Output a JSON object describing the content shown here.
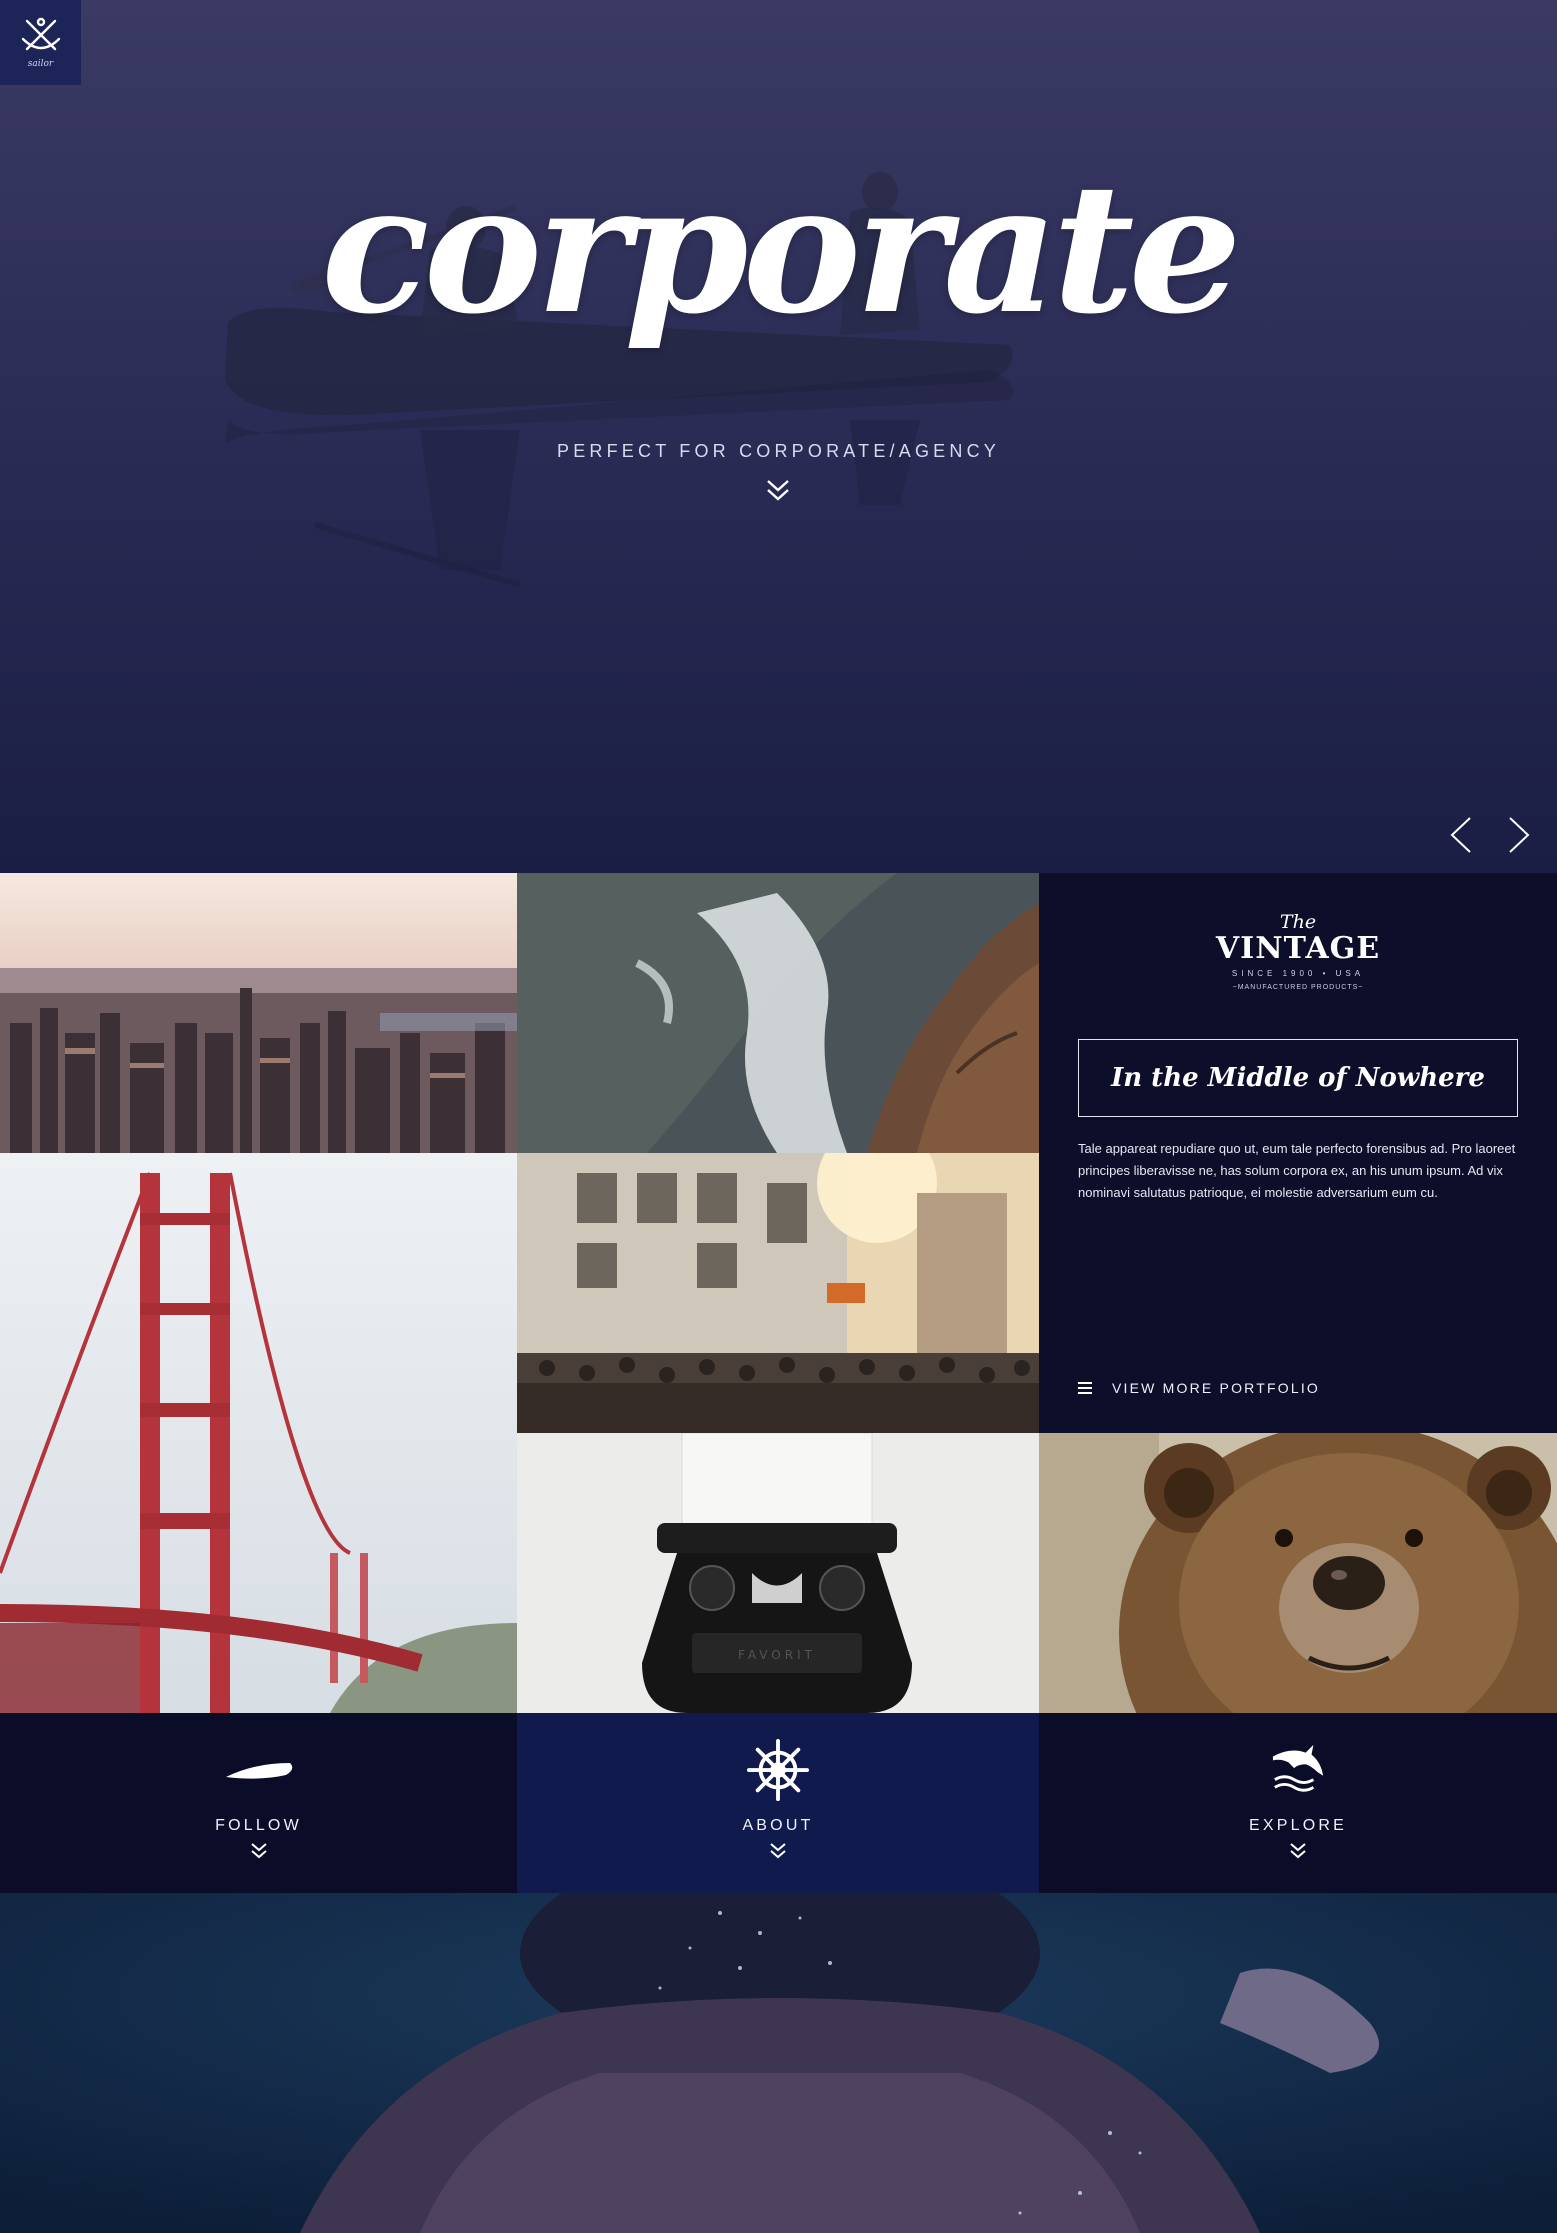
{
  "logo": {
    "icon": "anchor-icon",
    "subtext": "sailor"
  },
  "hero": {
    "title": "corporate",
    "subtitle": "PERFECT FOR CORPORATE/AGENCY",
    "scroll_icon": "double-chevron-down-icon",
    "prev_icon": "chevron-left-icon",
    "next_icon": "chevron-right-icon"
  },
  "portfolio": {
    "tiles": [
      "city skyline",
      "ocean wave on rocks",
      "golden gate bridge",
      "city street",
      "typewriter",
      "bear"
    ],
    "vintage": {
      "the": "The",
      "main": "VINTAGE",
      "since": "SINCE 1900 • USA",
      "manufactured": "~MANUFACTURED PRODUCTS~"
    },
    "tagline": "In the Middle of Nowhere",
    "description": "Tale appareat repudiare quo ut, eum tale perfecto forensibus ad. Pro laoreet principes liberavisse ne, has solum corpora ex, an his unum ipsum. Ad vix nominavi salutatus patrioque, ei molestie adversarium eum cu.",
    "more_link": "VIEW MORE PORTFOLIO",
    "more_icon": "menu-icon"
  },
  "features": [
    {
      "label": "FOLLOW",
      "icon": "surfboard-icon"
    },
    {
      "label": "ABOUT",
      "icon": "ship-wheel-icon"
    },
    {
      "label": "EXPLORE",
      "icon": "dolphin-icon"
    }
  ],
  "colors": {
    "hero_bg": "#2e2f58",
    "panel_bg": "#0d0e2a",
    "about_bg": "#111a4c",
    "text": "#ffffff"
  }
}
